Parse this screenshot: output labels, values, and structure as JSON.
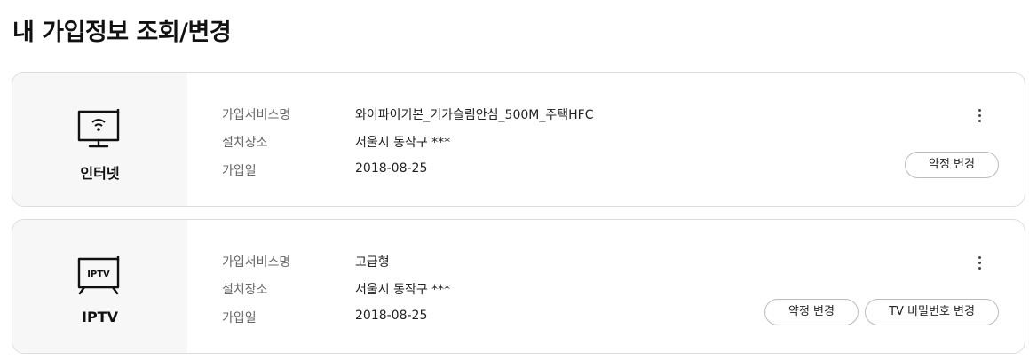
{
  "page_title": "내 가입정보 조회/변경",
  "labels": {
    "service_name": "가입서비스명",
    "location": "설치장소",
    "join_date": "가입일"
  },
  "cards": [
    {
      "type_name": "인터넷",
      "icon": "wifi-monitor-icon",
      "service_name": "와이파이기본_기가슬림안심_500M_주택HFC",
      "location": "서울시 동작구 ***",
      "join_date": "2018-08-25",
      "buttons": [
        "약정 변경"
      ]
    },
    {
      "type_name": "IPTV",
      "icon": "iptv-tv-icon",
      "icon_text": "IPTV",
      "service_name": "고급형",
      "location": "서울시 동작구 ***",
      "join_date": "2018-08-25",
      "buttons": [
        "약정 변경",
        "TV 비밀번호 변경"
      ]
    }
  ]
}
